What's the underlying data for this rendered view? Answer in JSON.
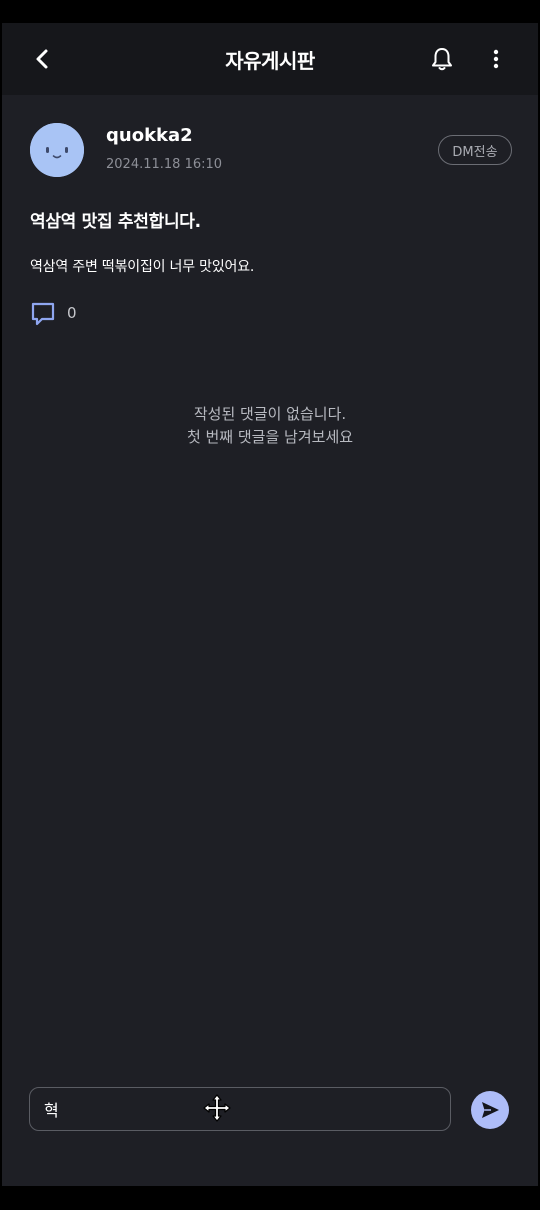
{
  "header": {
    "title": "자유게시판",
    "back_icon": "chevron-left-icon",
    "bell_icon": "bell-icon",
    "more_icon": "more-vertical-icon"
  },
  "post": {
    "author": "quokka2",
    "date": "2024.11.18 16:10",
    "dm_label": "DM전송",
    "title": "역삼역 맛집 추천합니다.",
    "body": "역삼역 주변 떡볶이집이 너무 맛있어요.",
    "comment_count": "0",
    "avatar_icon": "quokka-face-avatar"
  },
  "comments": {
    "empty_line1": "작성된 댓글이 없습니다.",
    "empty_line2": "첫 번째 댓글을 남겨보세요"
  },
  "composer": {
    "input_value": "혁",
    "send_icon": "send-icon",
    "cursor_icon": "move-cursor-icon"
  },
  "colors": {
    "background": "#1e1f25",
    "header_bg": "#16171b",
    "avatar": "#a9c4f5",
    "accent": "#aebdf8",
    "comment_icon": "#8fa6f0"
  }
}
